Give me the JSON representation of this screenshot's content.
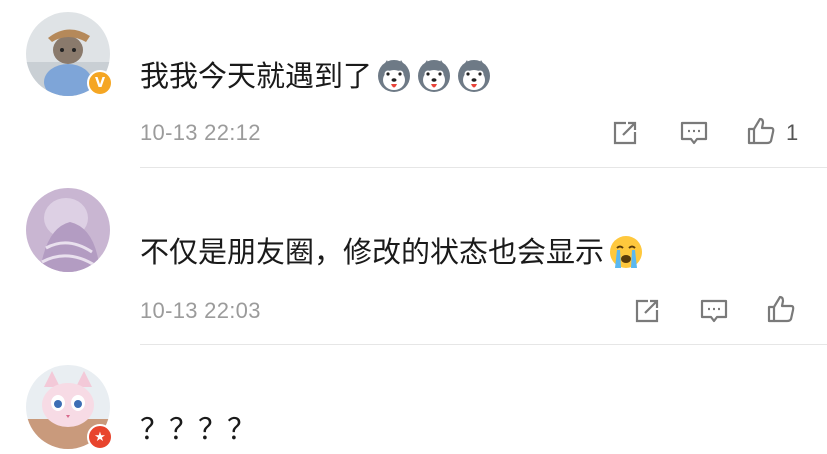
{
  "comments": [
    {
      "avatar": "cat-in-blue-sweater-avatar",
      "badge": {
        "type": "verified",
        "glyph": "V",
        "color": "#f5a623"
      },
      "text": "我我今天就遇到了",
      "emojis": [
        "husky-emoji",
        "husky-emoji",
        "husky-emoji"
      ],
      "time": "10-13 22:12",
      "likes": "1"
    },
    {
      "avatar": "purple-veil-avatar",
      "badge": null,
      "text": "不仅是朋友圈，修改的状态也会显示",
      "emojis": [
        "crying-face-emoji"
      ],
      "time": "10-13 22:03",
      "likes": ""
    },
    {
      "avatar": "pink-plush-cat-avatar",
      "badge": {
        "type": "member",
        "glyph": "★",
        "color": "#e8442d"
      },
      "text": "？？？？",
      "emojis": [],
      "time": "",
      "likes": ""
    }
  ],
  "icons": {
    "share": "share-icon",
    "comment": "comment-icon",
    "like": "thumbs-up-icon"
  },
  "colors": {
    "meta_text": "#9b9b9b",
    "divider": "#e6e6e6",
    "icon": "#7a7a7a"
  }
}
